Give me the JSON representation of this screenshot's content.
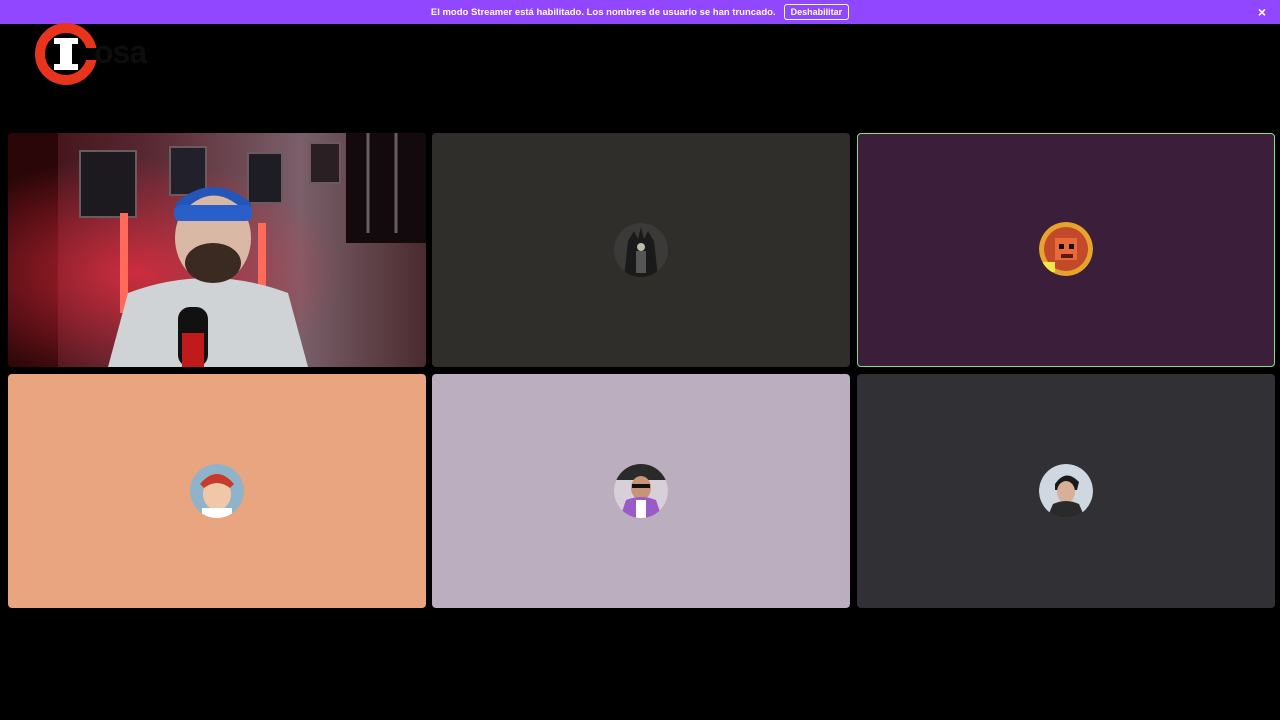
{
  "banner": {
    "message": "El modo Streamer está habilitado. Los nombres de usuario se han truncado.",
    "disable_label": "Deshabilitar",
    "close_glyph": "×",
    "background": "#9146ff"
  },
  "logo": {
    "wordmark": "osa"
  },
  "participants": [
    {
      "tile_color": "#2a0a0f",
      "video": true,
      "avatar_icon": "webcam-video",
      "speaking": false
    },
    {
      "tile_color": "#2f2e2b",
      "video": false,
      "avatar_icon": "iron-throne-avatar",
      "speaking": false
    },
    {
      "tile_color": "#3a1e3a",
      "video": false,
      "avatar_icon": "pixel-lion-avatar",
      "speaking": true
    },
    {
      "tile_color": "#e8a580",
      "video": false,
      "avatar_icon": "cartoon-redhead-avatar",
      "speaking": false
    },
    {
      "tile_color": "#bbaebf",
      "video": false,
      "avatar_icon": "man-sunglasses-avatar",
      "speaking": false
    },
    {
      "tile_color": "#313035",
      "video": false,
      "avatar_icon": "man-portrait-avatar",
      "speaking": false
    }
  ],
  "colors": {
    "speaking_outline": "#7ee08a",
    "logo_red": "#e8341c"
  }
}
